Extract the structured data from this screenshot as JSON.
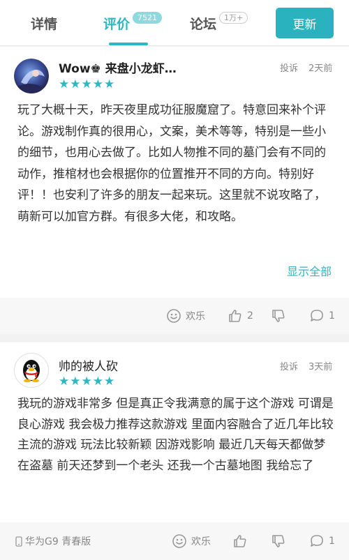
{
  "tabs": {
    "detail": {
      "label": "详情"
    },
    "review": {
      "label": "评价",
      "badge": "7521"
    },
    "forum": {
      "label": "论坛",
      "badge": "1万+"
    },
    "update_label": "更新"
  },
  "reviews": [
    {
      "username": "Wow♚ 来盘小龙虾…",
      "rating_stars": "★★★★★",
      "rating": 5,
      "report_label": "投诉",
      "time": "2天前",
      "text": "玩了大概十天，昨天夜里成功征服魔窟了。特意回来补个评论。游戏制作真的很用心，文案，美术等等，特别是一些小的细节，也用心去做了。比如人物推不同的墓门会有不同的动作，推棺材也会根据你的位置推开不同的方向。特别好评！！也安利了许多的朋友一起来玩。这里就不说攻略了，萌新可以加官方群。有很多大佬，和攻略。",
      "show_all_label": "显示全部",
      "fun_label": "欢乐",
      "likes": "2",
      "comments": "1"
    },
    {
      "username": "帅的被人砍",
      "rating_stars": "★★★★★",
      "rating": 5,
      "report_label": "投诉",
      "time": "3天前",
      "text": "我玩的游戏非常多 但是真正令我满意的属于这个游戏 可谓是良心游戏 我会极力推荐这款游戏 里面内容融合了近几年比较主流的游戏 玩法比较新颖 因游戏影响 最近几天每天都做梦在盗墓 前天还梦到一个老头 还我一个古墓地图 我给忘了",
      "device": "华为G9 青春版",
      "fun_label": "欢乐",
      "comments": "1"
    }
  ],
  "colors": {
    "accent": "#2cb7c2",
    "update_button": "#2ab3bf",
    "text": "#333333",
    "muted": "#888888",
    "background": "#f2f2f2"
  },
  "icons": [
    "smile-icon",
    "thumb-up-icon",
    "thumb-down-icon",
    "comment-icon",
    "phone-icon"
  ]
}
